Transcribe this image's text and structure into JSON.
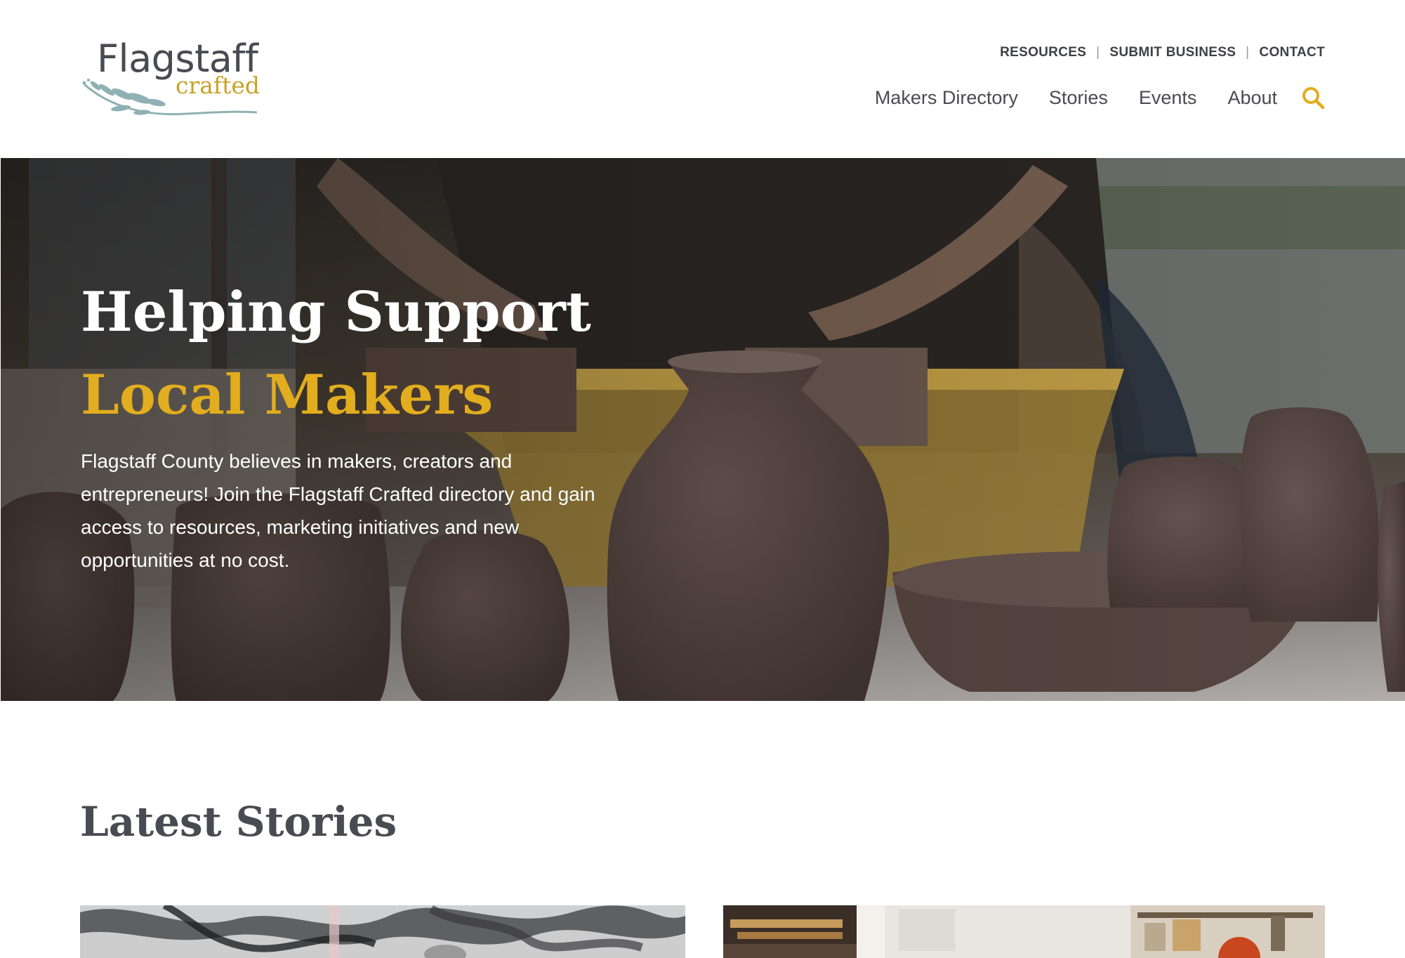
{
  "logo": {
    "wordmark": "Flagstaff",
    "sub": "crafted"
  },
  "utility_nav": [
    {
      "label": "RESOURCES"
    },
    {
      "label": "SUBMIT BUSINESS"
    },
    {
      "label": "CONTACT"
    }
  ],
  "utility_separator": "|",
  "main_nav": [
    {
      "label": "Makers Directory"
    },
    {
      "label": "Stories"
    },
    {
      "label": "Events"
    },
    {
      "label": "About"
    }
  ],
  "hero": {
    "title_line1": "Helping Support",
    "title_line2": "Local Makers",
    "text": "Flagstaff County believes in makers, creators and entrepreneurs! Join the Flagstaff Crafted directory and gain access to resources, marketing initiatives and new opportunities at no cost."
  },
  "latest_stories": {
    "title": "Latest Stories"
  },
  "colors": {
    "accent": "#e2ad1e",
    "logo_accent": "#c9a227",
    "text": "#4a4a52",
    "branch": "#8fb1b3"
  },
  "icons": {
    "search": "search-icon",
    "logo_branch": "branch-icon"
  }
}
